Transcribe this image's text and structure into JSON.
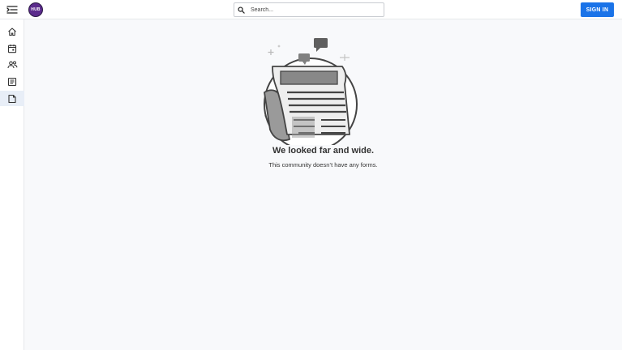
{
  "header": {
    "logo_text": "HUB",
    "search_placeholder": "Search...",
    "signin_label": "SIGN IN",
    "colors": {
      "accent": "#1a73e8",
      "logo_bg": "#5b2b8c"
    }
  },
  "sidebar": {
    "items": [
      {
        "icon": "home-icon"
      },
      {
        "icon": "calendar-icon"
      },
      {
        "icon": "people-icon"
      },
      {
        "icon": "posts-icon"
      },
      {
        "icon": "forms-icon",
        "active": true
      }
    ]
  },
  "empty_state": {
    "illustration": "newspaper-illustration",
    "title": "We looked far and wide.",
    "message": "This community doesn’t have any forms."
  }
}
